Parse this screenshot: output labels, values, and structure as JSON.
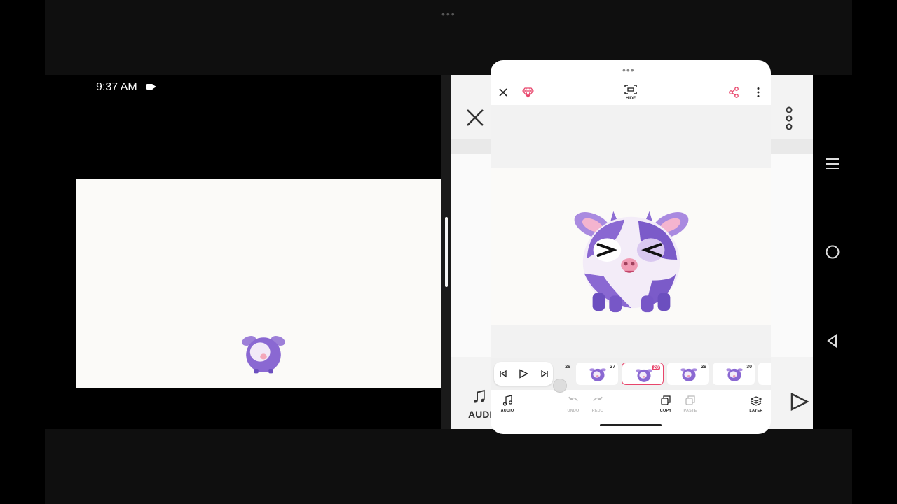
{
  "status_bar": {
    "time": "9:37 AM"
  },
  "popup": {
    "hide_label": "HIDE",
    "frames": [
      {
        "number": "26",
        "selected": false
      },
      {
        "number": "27",
        "selected": false
      },
      {
        "number": "28",
        "selected": true
      },
      {
        "number": "29",
        "selected": false
      },
      {
        "number": "30",
        "selected": false
      }
    ],
    "toolbar": {
      "audio": "AUDIO",
      "undo": "UNDO",
      "redo": "REDO",
      "copy": "COPY",
      "paste": "PASTE",
      "layer": "LAYER"
    }
  },
  "background_app": {
    "audio_label": "AUDI"
  },
  "colors": {
    "accent": "#e8456b",
    "cow_purple": "#7b5bc9",
    "cow_light": "#f2e9f7"
  }
}
